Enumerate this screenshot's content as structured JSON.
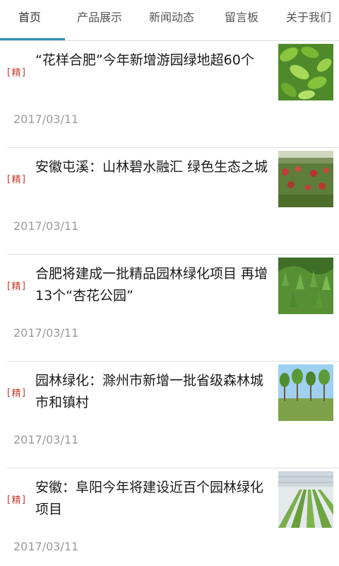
{
  "tabs": [
    {
      "label": "首页"
    },
    {
      "label": "产品展示"
    },
    {
      "label": "新闻动态"
    },
    {
      "label": "留言板"
    },
    {
      "label": "关于我们"
    }
  ],
  "tag_label": "精",
  "articles": [
    {
      "title": "“花样合肥”今年新增游园绿地超60个",
      "date": "2017/03/11",
      "thumb": "green-leaves-photo"
    },
    {
      "title": "安徽屯溪：山林碧水融汇 绿色生态之城",
      "date": "2017/03/11",
      "thumb": "nursery-field-photo"
    },
    {
      "title": "合肥将建成一批精品园林绿化项目 再增13个“杏花公园”",
      "date": "2017/03/11",
      "thumb": "green-shrubs-photo"
    },
    {
      "title": "园林绿化：滁州市新增一批省级森林城市和镇村",
      "date": "2017/03/11",
      "thumb": "tree-plantation-photo"
    },
    {
      "title": "安徽：阜阳今年将建设近百个园林绿化项目",
      "date": "2017/03/11",
      "thumb": "greenhouse-photo"
    }
  ]
}
